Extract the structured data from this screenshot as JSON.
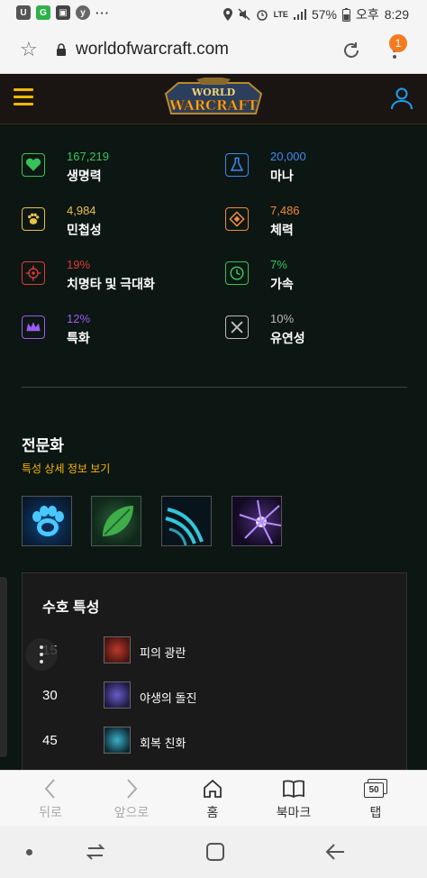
{
  "status_bar": {
    "battery": "57%",
    "time_period": "오후",
    "time": "8:29",
    "network": "LTE"
  },
  "url_bar": {
    "url": "worldofwarcraft.com",
    "notification_count": "1"
  },
  "site": {
    "logo_text_line1": "WORLD",
    "logo_text_line2": "WARCRAFT"
  },
  "stats": [
    {
      "value": "167,219",
      "name": "생명력",
      "icon": "heart-icon",
      "color": "#35c45a"
    },
    {
      "value": "20,000",
      "name": "마나",
      "icon": "flask-icon",
      "color": "#3e8af0"
    },
    {
      "value": "4,984",
      "name": "민첩성",
      "icon": "paw-icon",
      "color": "#e8c04a"
    },
    {
      "value": "7,486",
      "name": "체력",
      "icon": "diamond-icon",
      "color": "#f08a3c"
    },
    {
      "value": "19%",
      "name": "치명타 및 극대화",
      "icon": "target-icon",
      "color": "#e03a3a"
    },
    {
      "value": "7%",
      "name": "가속",
      "icon": "clock-icon",
      "color": "#35c45a"
    },
    {
      "value": "12%",
      "name": "특화",
      "icon": "crown-icon",
      "color": "#9a5cf0"
    },
    {
      "value": "10%",
      "name": "유연성",
      "icon": "tools-icon",
      "color": "#bbbbbb"
    }
  ],
  "specialization": {
    "title": "전문화",
    "link": "특성 상세 정보 보기",
    "spells": [
      "paw-spell-icon",
      "leaf-spell-icon",
      "claw-spell-icon",
      "burst-spell-icon"
    ]
  },
  "talents": {
    "title": "수호 특성",
    "rows": [
      {
        "level": "15",
        "name": "피의 광란",
        "icon": "blood-frenzy-icon"
      },
      {
        "level": "30",
        "name": "야생의 돌진",
        "icon": "wild-charge-icon"
      },
      {
        "level": "45",
        "name": "회복 친화",
        "icon": "restoration-affinity-icon"
      }
    ]
  },
  "bottom_nav": [
    {
      "label": "뒤로",
      "icon": "back-icon"
    },
    {
      "label": "앞으로",
      "icon": "forward-icon"
    },
    {
      "label": "홈",
      "icon": "home-icon"
    },
    {
      "label": "북마크",
      "icon": "bookmark-icon"
    },
    {
      "label": "탭",
      "icon": "tabs-icon",
      "count": "50"
    }
  ]
}
